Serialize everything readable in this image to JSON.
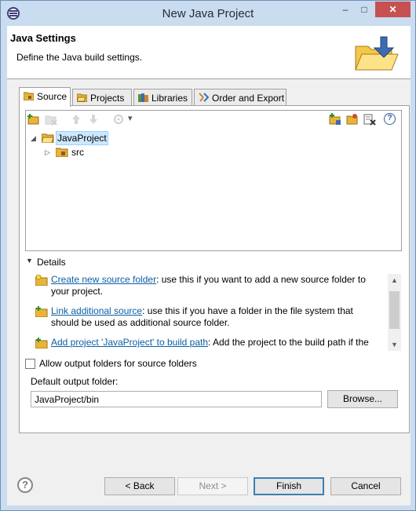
{
  "window": {
    "title": "New Java Project",
    "minimize": "–",
    "maximize": "□",
    "close": "✕"
  },
  "header": {
    "title": "Java Settings",
    "description": "Define the Java build settings."
  },
  "tabs": [
    {
      "label": "Source",
      "icon": "source-folder-icon",
      "active": true
    },
    {
      "label": "Projects",
      "icon": "projects-icon"
    },
    {
      "label": "Libraries",
      "icon": "libraries-icon"
    },
    {
      "label": "Order and Export",
      "icon": "order-export-icon"
    }
  ],
  "tree": {
    "root": {
      "label": "JavaProject",
      "expanded": true,
      "selected": true
    },
    "child": {
      "label": "src",
      "expanded": false
    },
    "toolbar_menu": "▾",
    "help": "?"
  },
  "details": {
    "toggle": "Details",
    "items": [
      {
        "link": "Create new source folder",
        "text": ": use this if you want to add a new source folder to your project."
      },
      {
        "link": "Link additional source",
        "text": ": use this if you have a folder in the file system that should be used as additional source folder."
      },
      {
        "link": "Add project 'JavaProject' to build path",
        "text": ": Add the project to the build path if the"
      }
    ]
  },
  "allow_output": {
    "label": "Allow output folders for source folders",
    "checked": false
  },
  "output": {
    "label": "Default output folder:",
    "value": "JavaProject/bin",
    "browse": "Browse..."
  },
  "buttons": {
    "help": "?",
    "back": "< Back",
    "next": "Next >",
    "finish": "Finish",
    "cancel": "Cancel"
  },
  "colors": {
    "link": "#0b5fa5",
    "folder": "#e8b43a",
    "selection": "#cce8ff"
  }
}
